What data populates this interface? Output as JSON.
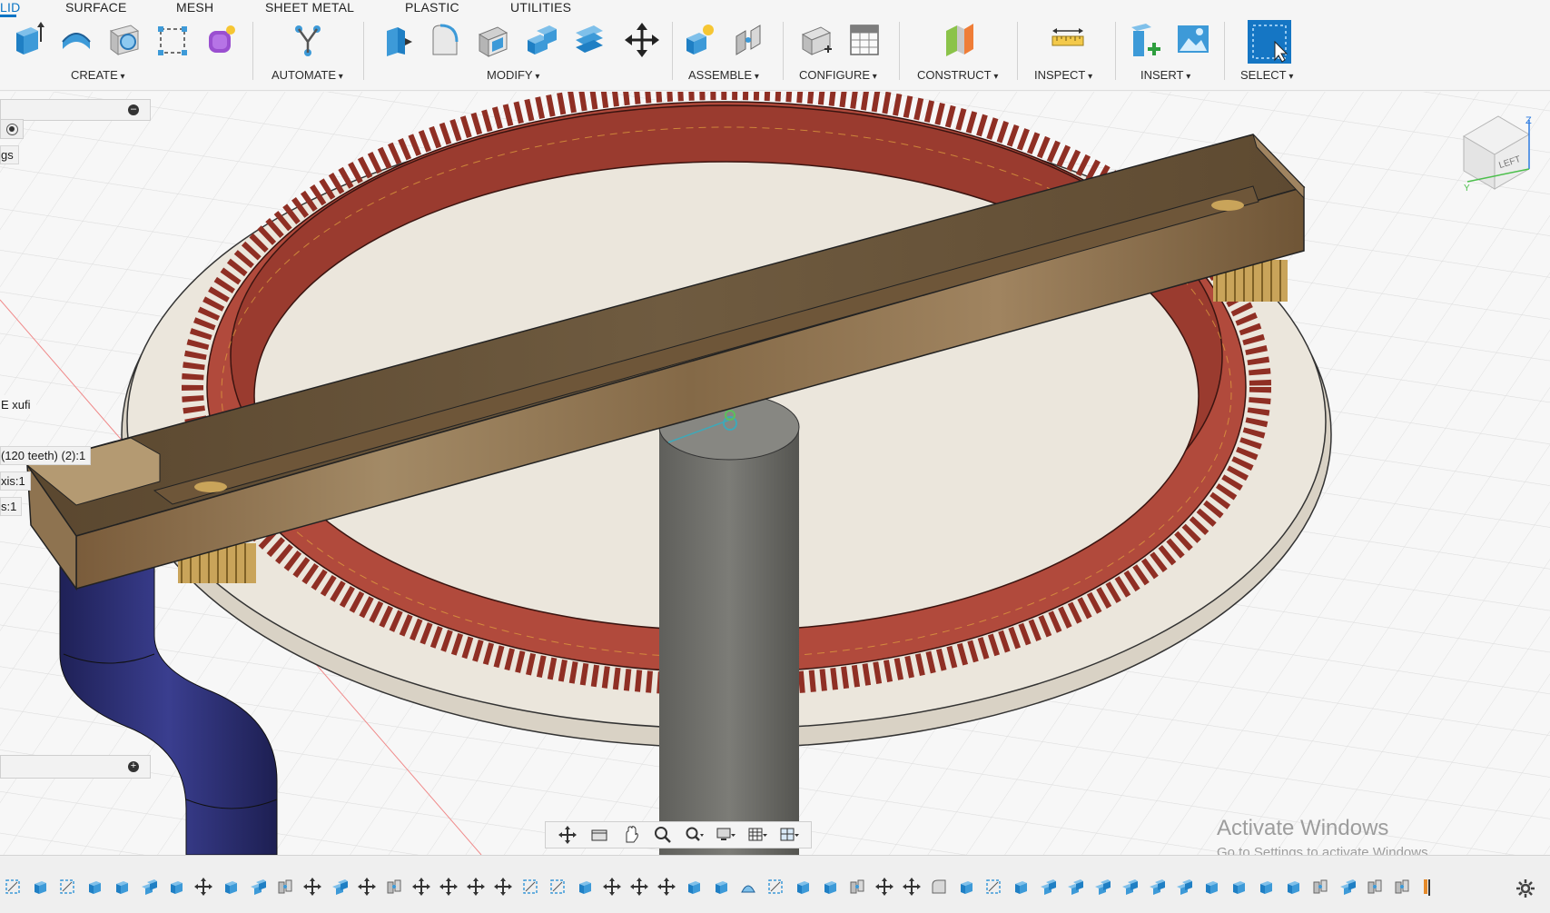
{
  "toolbar": {
    "tabs": [
      "LID",
      "SURFACE",
      "MESH",
      "SHEET METAL",
      "PLASTIC",
      "UTILITIES"
    ],
    "groups": {
      "create": "CREATE",
      "automate": "AUTOMATE",
      "modify": "MODIFY",
      "assemble": "ASSEMBLE",
      "configure": "CONFIGURE",
      "construct": "CONSTRUCT",
      "inspect": "INSPECT",
      "insert": "INSERT",
      "select": "SELECT"
    }
  },
  "browser": {
    "items": [
      "gs",
      "E xufi",
      "(120 teeth) (2):1",
      "xis:1",
      "s:1"
    ]
  },
  "viewcube": {
    "face_label": "LEFT",
    "axis_z": "Z",
    "axis_y": "Y"
  },
  "watermark": {
    "title": "Activate Windows",
    "subtitle": "Go to Settings to activate Windows."
  },
  "colors": {
    "accent": "#0a74c4",
    "ring_gear": "#b14a3c",
    "base_disc": "#e6e0d5",
    "wood": "#8a6d4a",
    "pillar": "#6e6e6a",
    "pipe": "#2b2e73"
  }
}
